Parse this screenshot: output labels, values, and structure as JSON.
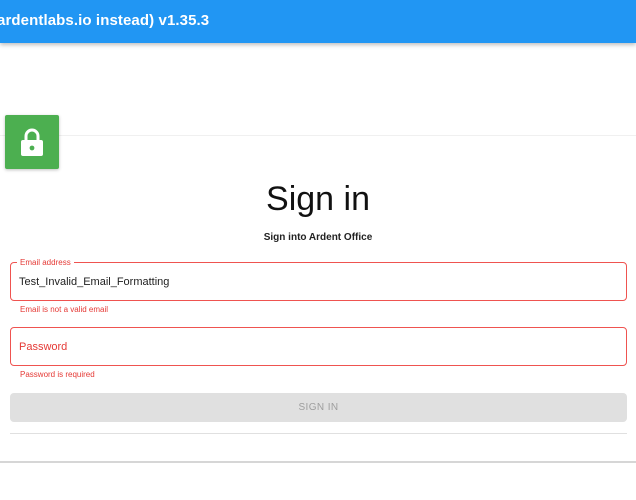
{
  "appbar": {
    "title": "ardentlabs.io instead) v1.35.3",
    "color": "#2196f3"
  },
  "icon": {
    "name": "lock-icon",
    "color": "#4caf50"
  },
  "signin": {
    "title": "Sign in",
    "subtitle": "Sign into Ardent Office",
    "email": {
      "label": "Email address",
      "value": "Test_Invalid_Email_Formatting",
      "error": "Email is not a valid email"
    },
    "password": {
      "placeholder": "Password",
      "value": "",
      "error": "Password is required"
    },
    "button_label": "SIGN IN",
    "error_color": "#e53935"
  }
}
